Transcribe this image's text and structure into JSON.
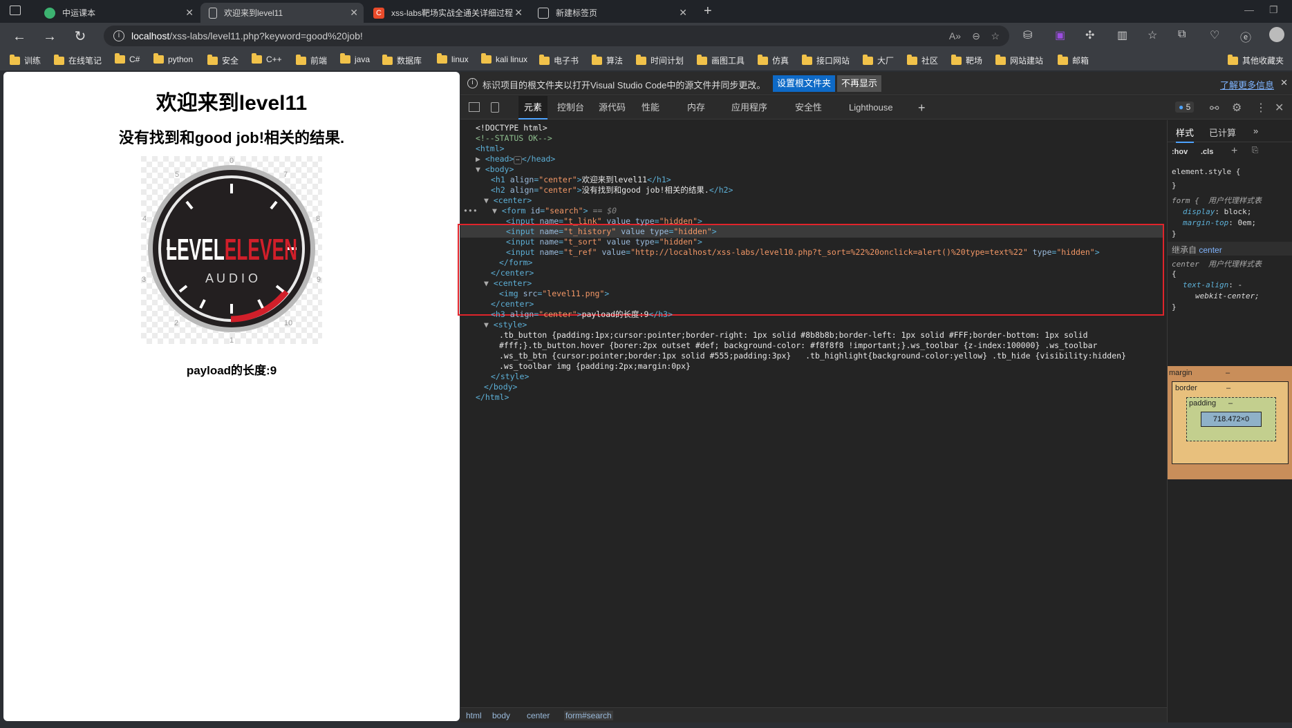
{
  "tabs": [
    {
      "title": "中运课本",
      "icon": "extension-tab-icon",
      "color": "#3cb371"
    },
    {
      "title": "欢迎来到level11",
      "icon": "page-tab-icon",
      "color": "#aaaaaa"
    },
    {
      "title": "xss-labs靶场实战全通关详细过程",
      "icon": "csdn-tab-icon",
      "color": "#e84a2a"
    },
    {
      "title": "新建标签页",
      "icon": "newtab-tab-icon",
      "color": "#aaaaaa"
    }
  ],
  "address": {
    "host": "localhost",
    "path": "/xss-labs/level11.php?keyword=good%20job!"
  },
  "bookmarks": [
    "训练",
    "在线笔记",
    "C#",
    "python",
    "安全",
    "C++",
    "前端",
    "java",
    "数据库",
    "linux",
    "kali linux",
    "电子书",
    "算法",
    "时间计划",
    "画图工具",
    "仿真",
    "接口网站",
    "大厂",
    "社区",
    "靶场",
    "网站建站",
    "邮箱"
  ],
  "other_bookmarks": "其他收藏夹",
  "page": {
    "h1": "欢迎来到level11",
    "h2": "没有找到和good job!相关的结果.",
    "h3": "payload的长度:9",
    "logo": {
      "word1": "LEVEL",
      "word2": "ELEVEN",
      "sub": "A U D I O",
      "dial_numbers": [
        "0",
        "7",
        "8",
        "9",
        "10",
        "1",
        "2",
        "3",
        "4",
        "5"
      ]
    }
  },
  "devtools": {
    "info_text": "标识项目的根文件夹以打开Visual Studio Code中的源文件并同步更改。",
    "set_root_btn": "设置根文件夹",
    "dont_show_btn": "不再显示",
    "learn_more": "了解更多信息",
    "tabs": [
      "元素",
      "控制台",
      "源代码",
      "性能",
      "内存",
      "应用程序",
      "安全性",
      "Lighthouse"
    ],
    "issues_count": "5",
    "styles_tabs": [
      "样式",
      "已计算"
    ],
    "hov": ":hov",
    "cls": ".cls",
    "style_rules": {
      "element_style": "element.style {",
      "close": "}",
      "form_sel": "form {",
      "ua": "用户代理样式表",
      "display_prop": "display",
      "display_val": "block;",
      "margintop_prop": "margin-top",
      "margintop_val": "0em;",
      "inherit": "继承自",
      "inherit_link": "center",
      "center_sel": "center",
      "center_brace": "{",
      "textalign_prop": "text-align",
      "textalign_val": "-",
      "textalign_val2": "webkit-center;"
    },
    "box_model": {
      "margin": "margin",
      "border": "border",
      "padding": "padding",
      "content": "718.472×0",
      "dash": "–"
    },
    "breadcrumbs": [
      "html",
      "body",
      "center",
      "form#search"
    ]
  },
  "dom": {
    "doctype": "<!DOCTYPE html>",
    "status_comment": "<!--STATUS OK-->",
    "h1_text": "欢迎来到level11",
    "h2_text": "没有找到和good job!相关的结果.",
    "h3_text": "payload的长度:9",
    "t_ref_value": "http://localhost/xss-labs/level10.php?t_sort=%22%20onclick=alert()%20type=text%22",
    "img_src": "level11.png",
    "selected_marker": "== $0",
    "style_line1": ".tb_button {padding:1px;cursor:pointer;border-right: 1px solid #8b8b8b;border-left: 1px solid #FFF;border-bottom: 1px solid",
    "style_line2": "#fff;}.tb_button.hover {borer:2px outset #def; background-color: #f8f8f8 !important;}.ws_toolbar {z-index:100000} .ws_toolbar",
    "style_line3": ".ws_tb_btn {cursor:pointer;border:1px solid #555;padding:3px}   .tb_highlight{background-color:yellow} .tb_hide {visibility:hidden}",
    "style_line4": ".ws_toolbar img {padding:2px;margin:0px}"
  }
}
